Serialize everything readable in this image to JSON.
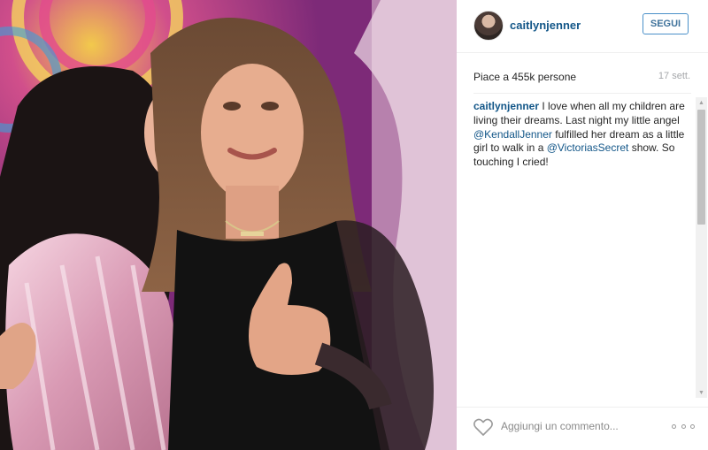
{
  "post": {
    "username": "caitlynjenner",
    "follow_label": "SEGUI",
    "likes_text": "Piace a 455k persone",
    "date_text": "17 sett.",
    "caption": {
      "author": "caitlynjenner",
      "part1": " I love when all my children are living their dreams. Last night my little angel ",
      "mention1": "@KendallJenner",
      "part2": " fulfilled her dream as a little girl to walk in a ",
      "mention2": "@VictoriasSecret",
      "part3": " show. So touching I cried!"
    },
    "comment_placeholder": "Aggiungi un commento...",
    "icons": {
      "like": "heart-outline-icon",
      "more": "more-options-icon",
      "scroll_up": "arrow-up-icon",
      "scroll_down": "arrow-down-icon"
    }
  },
  "colors": {
    "username_blue": "#125688",
    "follow_border": "#4a90c9",
    "photo_background": "#8a2a7c"
  }
}
